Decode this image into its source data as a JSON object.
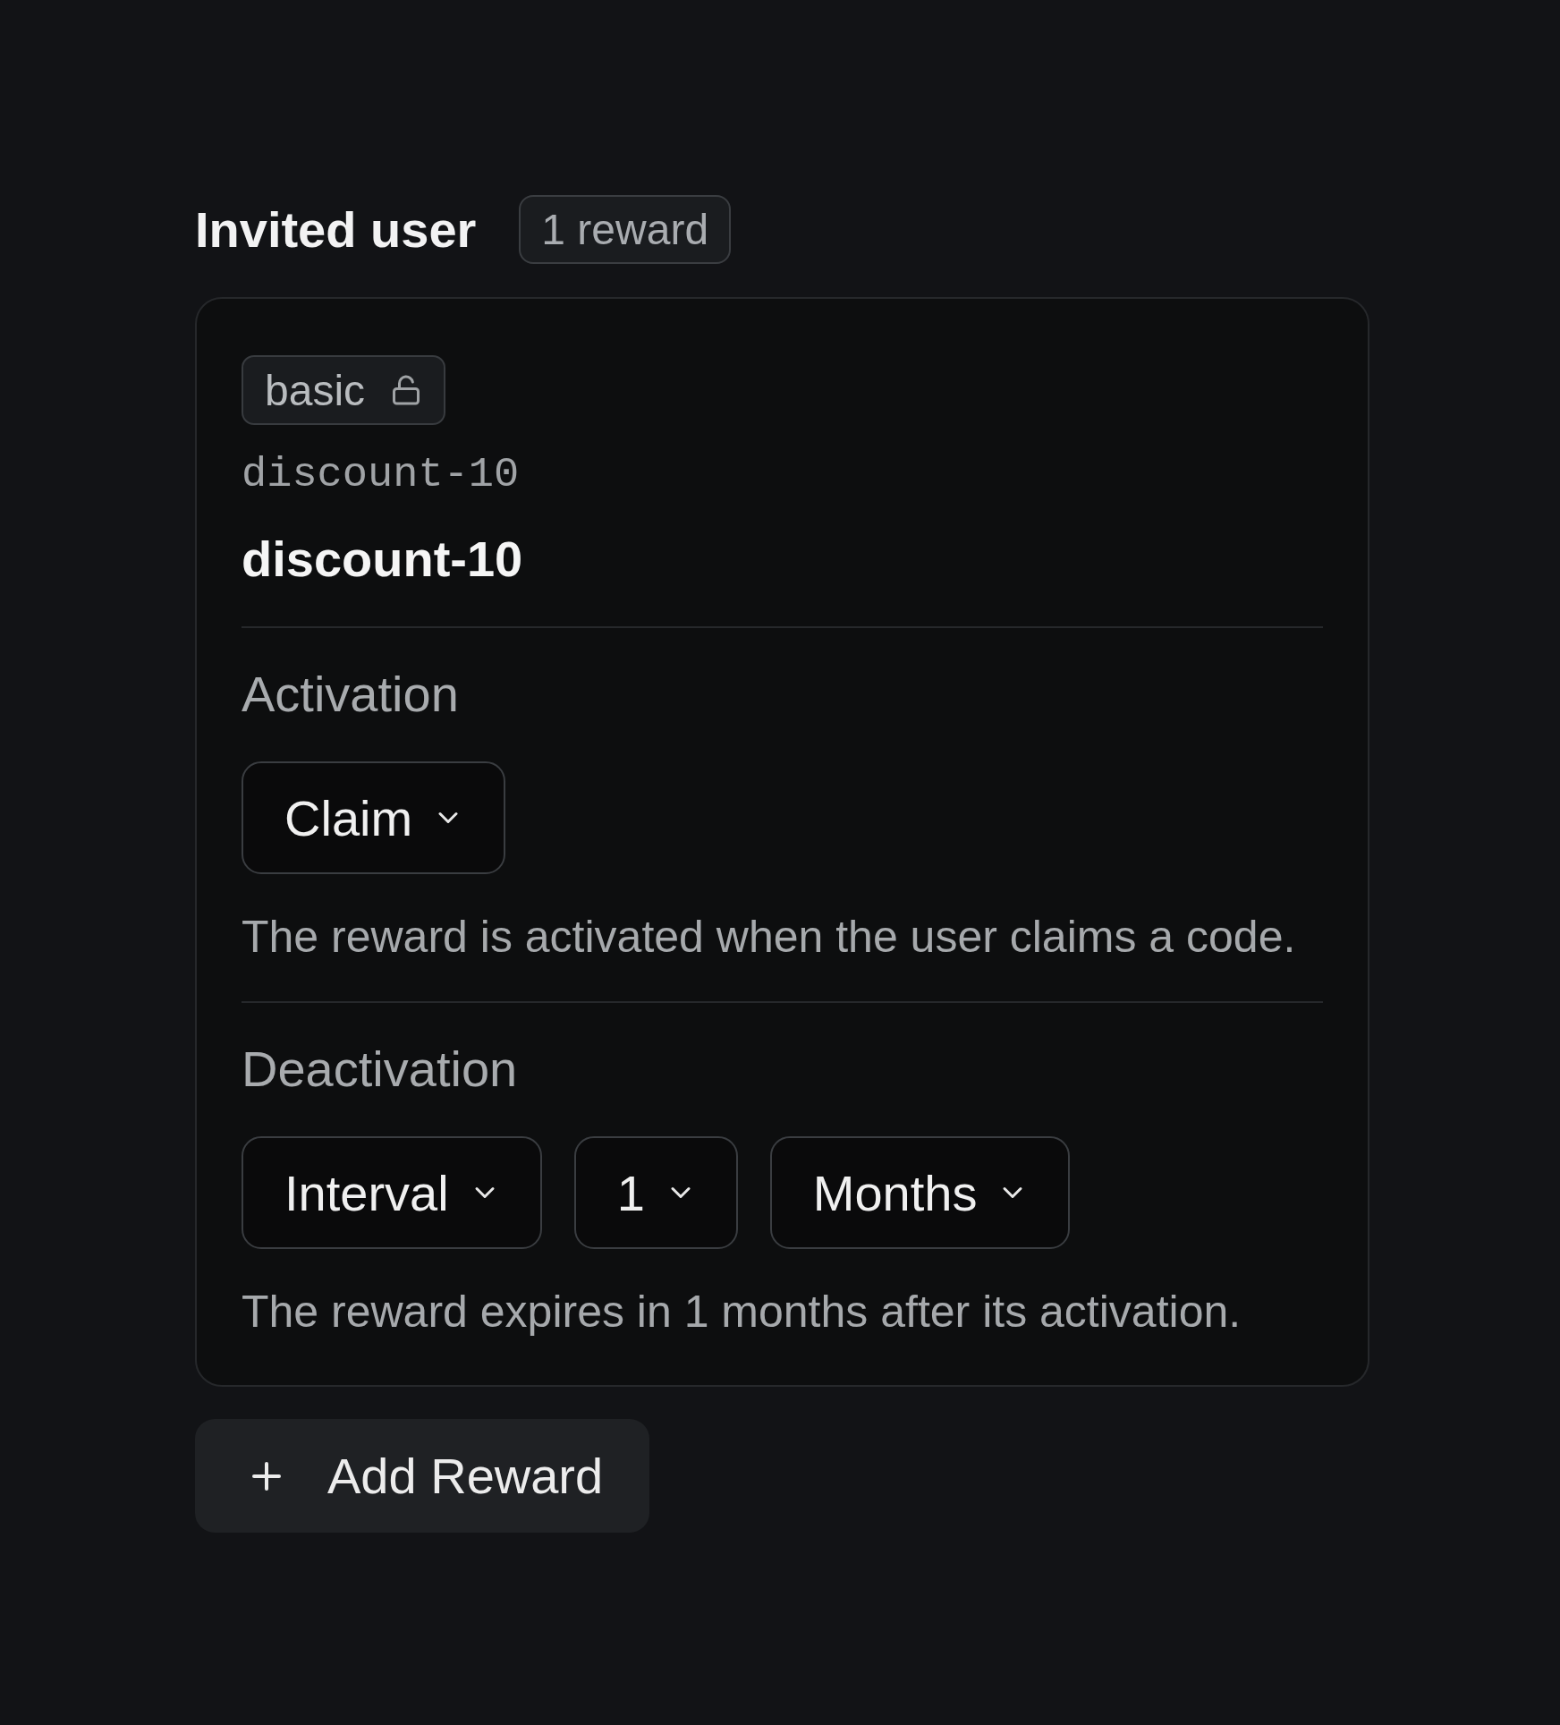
{
  "section": {
    "title": "Invited user",
    "count_badge": "1 reward"
  },
  "rewards": [
    {
      "tier": {
        "label": "basic",
        "locked": false
      },
      "code": "discount-10",
      "name": "discount-10",
      "settings": [
        {
          "label": "Activation",
          "selects": [
            {
              "value": "Claim"
            }
          ],
          "description": "The reward is activated when the user claims a code."
        },
        {
          "label": "Deactivation",
          "selects": [
            {
              "value": "Interval"
            },
            {
              "value": "1"
            },
            {
              "value": "Months"
            }
          ],
          "description": "The reward expires in 1 months after its activation."
        }
      ]
    }
  ],
  "add_button": {
    "label": "Add Reward"
  }
}
